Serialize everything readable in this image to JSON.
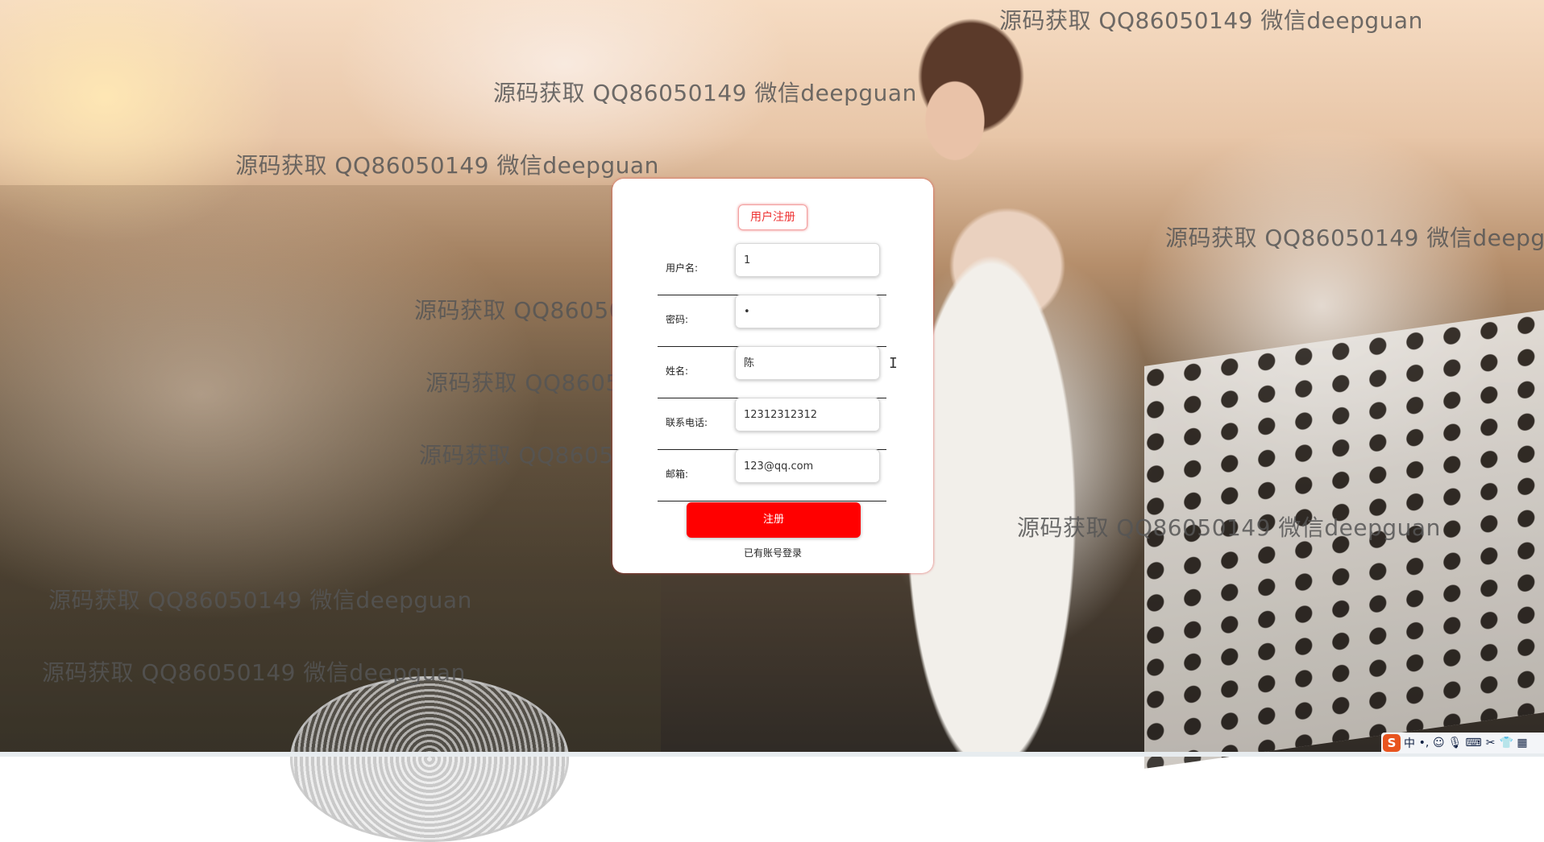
{
  "watermark_text": "源码获取 QQ86050149 微信deepguan",
  "form": {
    "title": "用户注册",
    "fields": [
      {
        "label": "用户名:",
        "value": "1"
      },
      {
        "label": "密码:",
        "value": "•"
      },
      {
        "label": "姓名:",
        "value": "陈"
      },
      {
        "label": "联系电话:",
        "value": "12312312312"
      },
      {
        "label": "邮箱:",
        "value": "123@qq.com"
      }
    ],
    "submit_label": "注册",
    "login_link": "已有账号登录"
  },
  "tray": {
    "ime_mode": "中",
    "icons": [
      "sogou-icon",
      "punctuation-icon",
      "emoji-icon",
      "mic-icon",
      "keyboard-icon",
      "tools-icon",
      "skin-icon",
      "menu-icon"
    ]
  },
  "colors": {
    "accent": "#ff0000",
    "title_border": "#f3a0a0"
  }
}
